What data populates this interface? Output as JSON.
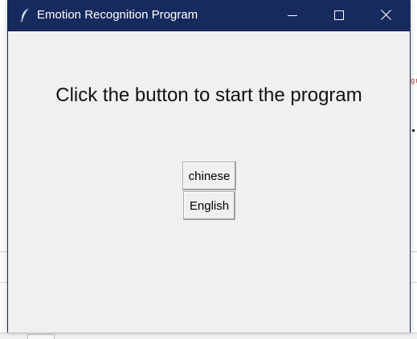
{
  "window": {
    "title": "Emotion Recognition Program",
    "title_bar_color": "#172a5e",
    "controls": {
      "minimize_icon": "minimize-icon",
      "maximize_icon": "maximize-icon",
      "close_icon": "close-icon"
    },
    "app_icon": "feather-icon"
  },
  "main": {
    "prompt": "Click the button to start the program",
    "buttons": {
      "chinese": "chinese",
      "english": "English"
    }
  },
  "background": {
    "glyph": "gr"
  }
}
